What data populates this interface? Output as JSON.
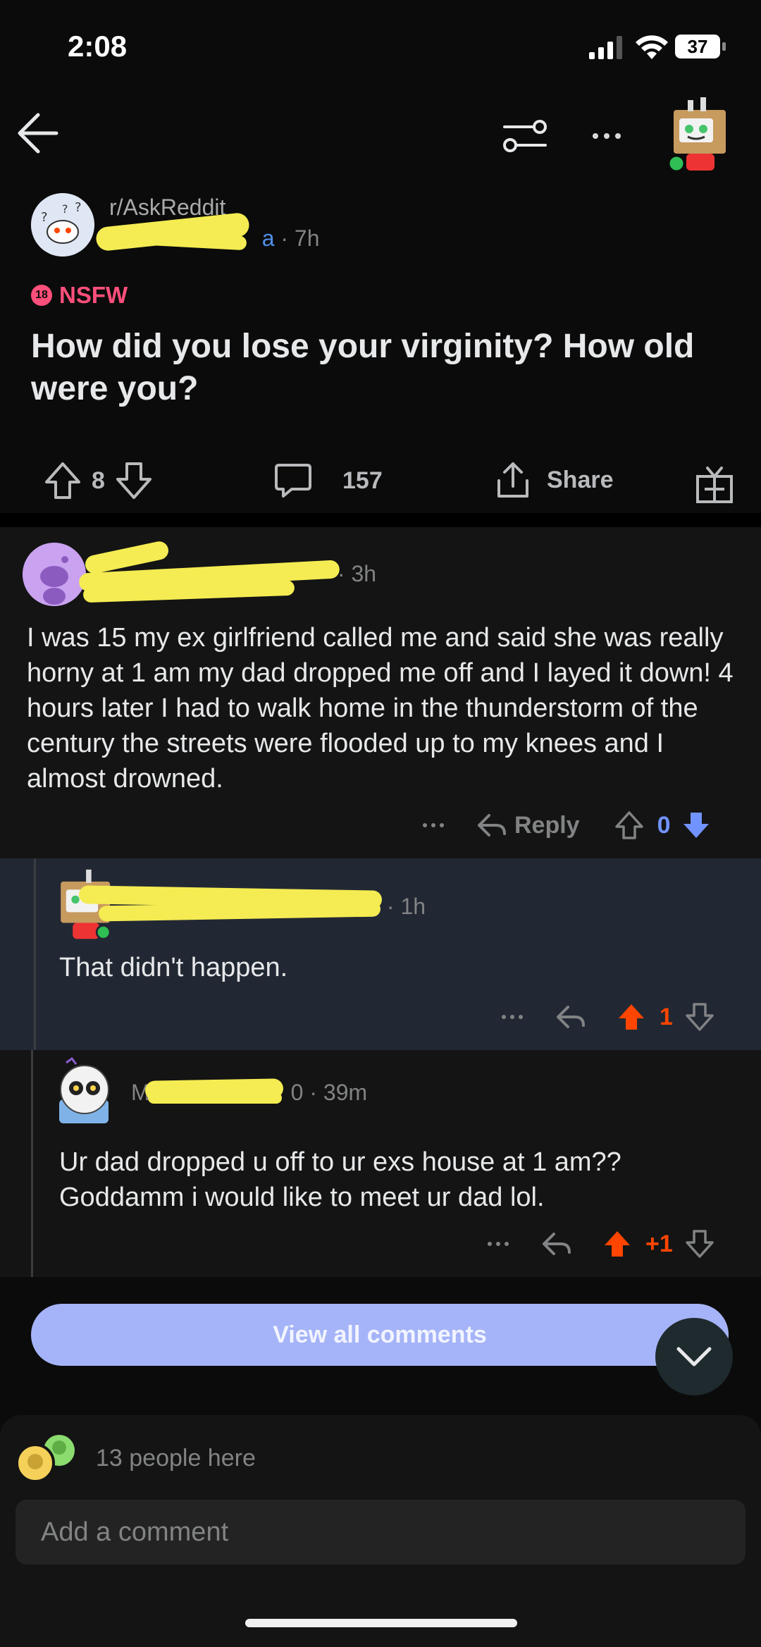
{
  "status_bar": {
    "time": "2:08",
    "battery": "37"
  },
  "post": {
    "subreddit": "r/AskReddit",
    "username_visible": "u/",
    "username_tail": "a",
    "age": "7h",
    "nsfw_badge": "18",
    "nsfw_label": "NSFW",
    "title": "How did you lose your virginity? How old were you?",
    "votes": "8",
    "comments": "157",
    "share_label": "Share"
  },
  "comments": [
    {
      "age": "3h",
      "body": "I was 15 my ex girlfriend called me and said she was really horny at 1 am my dad dropped me off and I layed it down! 4 hours later I had to walk home in the thunderstorm of the century the streets were flooded up to my knees and I almost drowned.",
      "reply_label": "Reply",
      "votes": "0",
      "vote_state": "downvoted"
    },
    {
      "age": "1h",
      "body": "That didn't happen.",
      "votes": "1",
      "vote_state": "upvoted"
    },
    {
      "name_start": "M",
      "name_end": "0",
      "age": "39m",
      "body": "Ur dad dropped u off to ur exs house at 1 am?? Goddamm i would like to meet ur dad lol.",
      "votes": "+1",
      "vote_state": "upvoted"
    }
  ],
  "view_all_label": "View all comments",
  "footer": {
    "presence": "13 people here",
    "input_placeholder": "Add a comment"
  },
  "colors": {
    "upvote": "#ff4500",
    "downvote": "#7193ff",
    "nsfw": "#ff4f7b",
    "link": "#4f8fe8",
    "view_all_bg": "#a5b4f8",
    "highlight_comment_bg": "#222833"
  }
}
